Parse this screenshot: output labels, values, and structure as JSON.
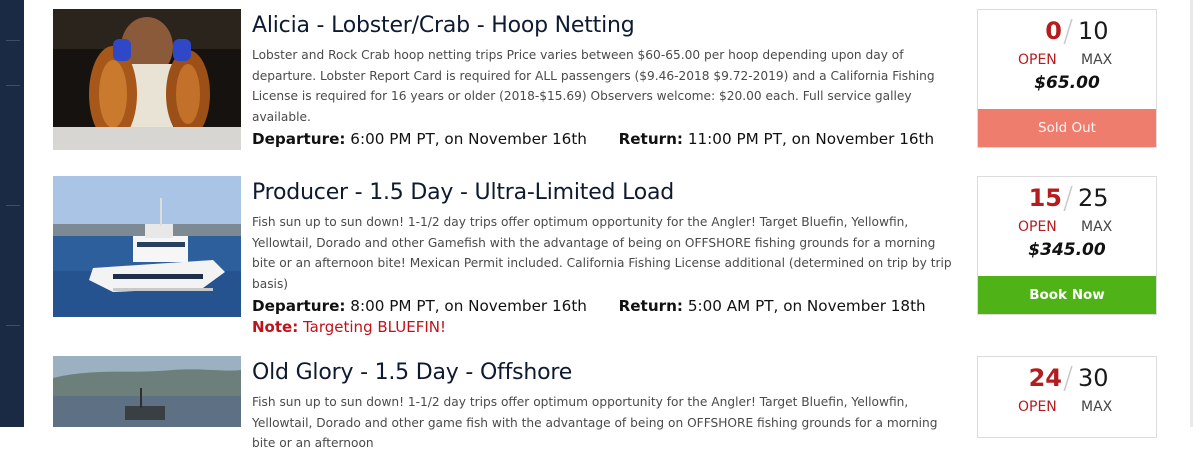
{
  "trips": [
    {
      "title": "Alicia - Lobster/Crab - Hoop Netting",
      "description": "Lobster and Rock Crab hoop netting trips Price varies between $60-65.00 per hoop depending upon day of departure. Lobster Report Card is required for ALL passengers ($9.46-2018 $9.72-2019) and a California Fishing License is required for 16 years or older (2018-$15.69) Observers welcome: $20.00 each. Full service galley available.",
      "departure_label": "Departure:",
      "departure": "6:00 PM PT, on November 16th",
      "return_label": "Return:",
      "return": "11:00 PM PT, on November 16th",
      "open": "0",
      "max": "10",
      "open_label": "OPEN",
      "max_label": "MAX",
      "price": "$65.00",
      "button": "Sold Out",
      "button_color": "#ee7d6d"
    },
    {
      "title": "Producer - 1.5 Day - Ultra-Limited Load",
      "description": "Fish sun up to sun down! 1-1/2 day trips offer optimum opportunity for the Angler! Target Bluefin, Yellowfin, Yellowtail, Dorado and other Gamefish with the advantage of being on OFFSHORE fishing grounds for a morning bite or an afternoon bite! Mexican Permit included. California Fishing License additional (determined on trip by trip basis)",
      "departure_label": "Departure:",
      "departure": "8:00 PM PT, on November 16th",
      "return_label": "Return:",
      "return": "5:00 AM PT, on November 18th",
      "note_label": "Note:",
      "note": "Targeting BLUEFIN!",
      "open": "15",
      "max": "25",
      "open_label": "OPEN",
      "max_label": "MAX",
      "price": "$345.00",
      "button": "Book Now",
      "button_color": "#4fb317"
    },
    {
      "title": "Old Glory - 1.5 Day - Offshore",
      "description": "Fish sun up to sun down! 1-1/2 day trips offer optimum opportunity for the Angler! Target Bluefin, Yellowfin, Yellowtail, Dorado and other game fish with the advantage of being on OFFSHORE fishing grounds for a morning bite or an afternoon",
      "open": "24",
      "max": "30",
      "open_label": "OPEN",
      "max_label": "MAX"
    }
  ],
  "colors": {
    "sidebar": "#1b2a44",
    "open_red": "#b51c1e",
    "note_red": "#c0121b",
    "title_navy": "#0e1a30"
  }
}
